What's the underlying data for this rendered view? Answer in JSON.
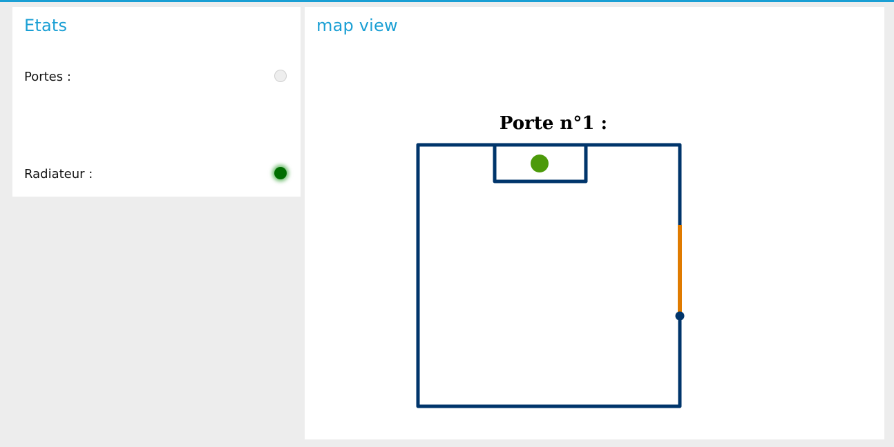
{
  "states_panel": {
    "title": "Etats",
    "items": [
      {
        "label": "Portes :",
        "indicator": "off",
        "indicator_color": "#eeeeee"
      },
      {
        "label": "Radiateur :",
        "indicator": "on",
        "indicator_color": "#006e00"
      }
    ]
  },
  "map_panel": {
    "title": "map view",
    "caption": "Porte n°1 :",
    "colors": {
      "wall": "#00356b",
      "door": "#e07b00",
      "radiator": "#4c9a0a",
      "accent": "#1a9fd4"
    }
  }
}
